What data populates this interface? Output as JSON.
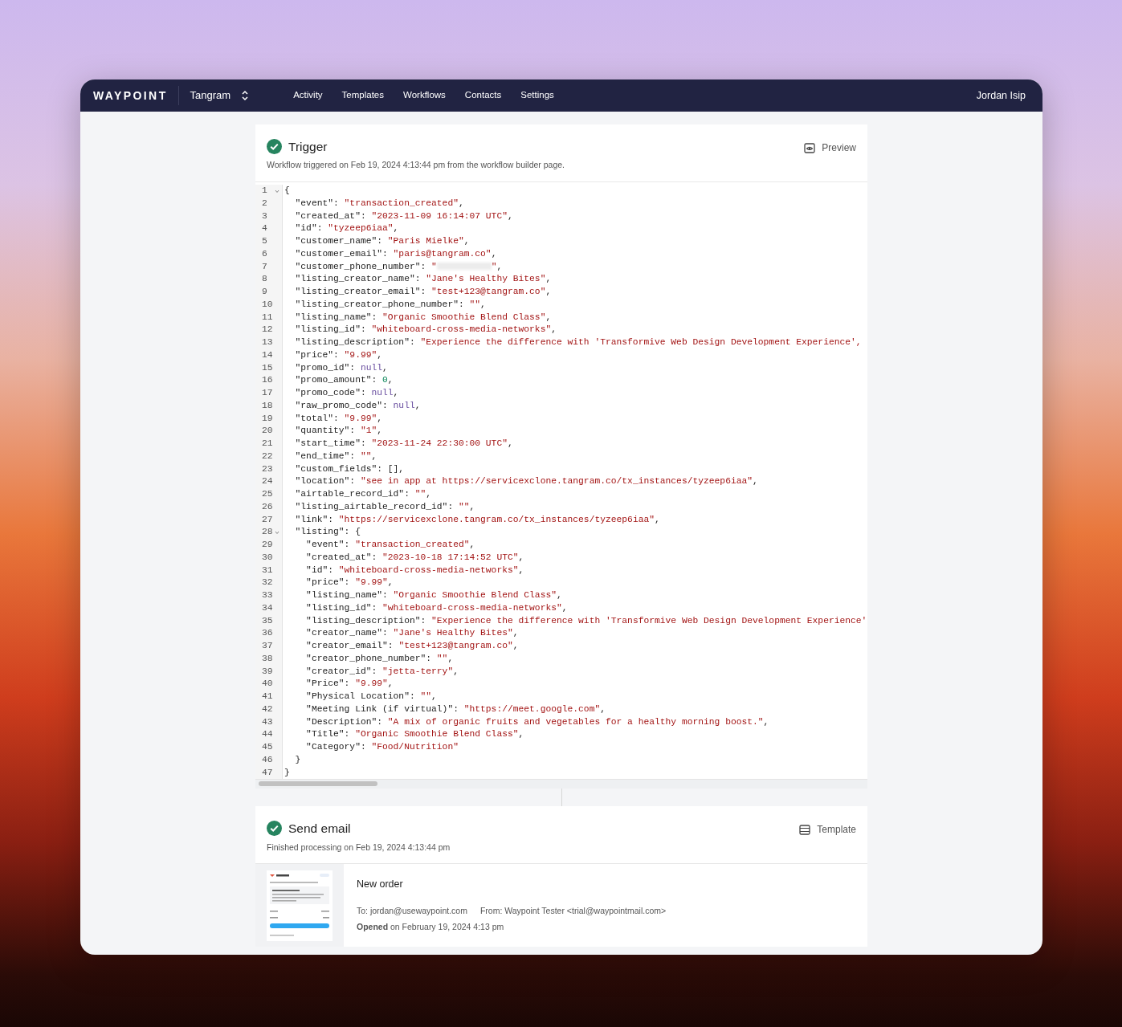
{
  "navbar": {
    "brand": "WAYPOINT",
    "workspace": "Tangram",
    "links": [
      {
        "label": "Activity",
        "selected": false
      },
      {
        "label": "Templates",
        "selected": false
      },
      {
        "label": "Workflows",
        "selected": false
      },
      {
        "label": "Contacts",
        "selected": false
      },
      {
        "label": "Settings",
        "selected": false
      }
    ],
    "user": "Jordan Isip"
  },
  "trigger": {
    "title": "Trigger",
    "done": true,
    "action": "Preview",
    "subtitle": "Workflow triggered on Feb 19, 2024 4:13:44 pm from the workflow builder page.",
    "code": [
      {
        "number": "1",
        "expanded": true,
        "tokens": [
          {
            "kind": "plain",
            "text": "{"
          }
        ]
      },
      {
        "number": "2",
        "tokens": [
          {
            "kind": "plain",
            "text": "  \"event\": "
          },
          {
            "kind": "string",
            "text": "\"transaction_created\""
          },
          {
            "kind": "plain",
            "text": ","
          }
        ]
      },
      {
        "number": "3",
        "tokens": [
          {
            "kind": "plain",
            "text": "  \"created_at\": "
          },
          {
            "kind": "string",
            "text": "\"2023-11-09 16:14:07 UTC\""
          },
          {
            "kind": "plain",
            "text": ","
          }
        ]
      },
      {
        "number": "4",
        "tokens": [
          {
            "kind": "plain",
            "text": "  \"id\": "
          },
          {
            "kind": "string",
            "text": "\"tyzeep6iaa\""
          },
          {
            "kind": "plain",
            "text": ","
          }
        ]
      },
      {
        "number": "5",
        "tokens": [
          {
            "kind": "plain",
            "text": "  \"customer_name\": "
          },
          {
            "kind": "string",
            "text": "\"Paris Mielke\""
          },
          {
            "kind": "plain",
            "text": ","
          }
        ]
      },
      {
        "number": "6",
        "tokens": [
          {
            "kind": "plain",
            "text": "  \"customer_email\": "
          },
          {
            "kind": "string",
            "text": "\"paris@tangram.co\""
          },
          {
            "kind": "plain",
            "text": ","
          }
        ]
      },
      {
        "number": "7",
        "tokens": [
          {
            "kind": "plain",
            "text": "  \"customer_phone_number\": "
          },
          {
            "kind": "string",
            "text": "\""
          },
          {
            "kind": "redacted"
          },
          {
            "kind": "string",
            "text": "\""
          },
          {
            "kind": "plain",
            "text": ","
          }
        ]
      },
      {
        "number": "8",
        "tokens": [
          {
            "kind": "plain",
            "text": "  \"listing_creator_name\": "
          },
          {
            "kind": "string",
            "text": "\"Jane's Healthy Bites\""
          },
          {
            "kind": "plain",
            "text": ","
          }
        ]
      },
      {
        "number": "9",
        "tokens": [
          {
            "kind": "plain",
            "text": "  \"listing_creator_email\": "
          },
          {
            "kind": "string",
            "text": "\"test+123@tangram.co\""
          },
          {
            "kind": "plain",
            "text": ","
          }
        ]
      },
      {
        "number": "10",
        "tokens": [
          {
            "kind": "plain",
            "text": "  \"listing_creator_phone_number\": "
          },
          {
            "kind": "string",
            "text": "\"\""
          },
          {
            "kind": "plain",
            "text": ","
          }
        ]
      },
      {
        "number": "11",
        "tokens": [
          {
            "kind": "plain",
            "text": "  \"listing_name\": "
          },
          {
            "kind": "string",
            "text": "\"Organic Smoothie Blend Class\""
          },
          {
            "kind": "plain",
            "text": ","
          }
        ]
      },
      {
        "number": "12",
        "tokens": [
          {
            "kind": "plain",
            "text": "  \"listing_id\": "
          },
          {
            "kind": "string",
            "text": "\"whiteboard-cross-media-networks\""
          },
          {
            "kind": "plain",
            "text": ","
          }
        ]
      },
      {
        "number": "13",
        "tokens": [
          {
            "kind": "plain",
            "text": "  \"listing_description\": "
          },
          {
            "kind": "string",
            "text": "\"Experience the difference with 'Transformive Web Design Development Experience',"
          }
        ]
      },
      {
        "number": "14",
        "tokens": [
          {
            "kind": "plain",
            "text": "  \"price\": "
          },
          {
            "kind": "string",
            "text": "\"9.99\""
          },
          {
            "kind": "plain",
            "text": ","
          }
        ]
      },
      {
        "number": "15",
        "tokens": [
          {
            "kind": "plain",
            "text": "  \"promo_id\": "
          },
          {
            "kind": "keyword",
            "text": "null"
          },
          {
            "kind": "plain",
            "text": ","
          }
        ]
      },
      {
        "number": "16",
        "tokens": [
          {
            "kind": "plain",
            "text": "  \"promo_amount\": "
          },
          {
            "kind": "number",
            "text": "0"
          },
          {
            "kind": "plain",
            "text": ","
          }
        ]
      },
      {
        "number": "17",
        "tokens": [
          {
            "kind": "plain",
            "text": "  \"promo_code\": "
          },
          {
            "kind": "keyword",
            "text": "null"
          },
          {
            "kind": "plain",
            "text": ","
          }
        ]
      },
      {
        "number": "18",
        "tokens": [
          {
            "kind": "plain",
            "text": "  \"raw_promo_code\": "
          },
          {
            "kind": "keyword",
            "text": "null"
          },
          {
            "kind": "plain",
            "text": ","
          }
        ]
      },
      {
        "number": "19",
        "tokens": [
          {
            "kind": "plain",
            "text": "  \"total\": "
          },
          {
            "kind": "string",
            "text": "\"9.99\""
          },
          {
            "kind": "plain",
            "text": ","
          }
        ]
      },
      {
        "number": "20",
        "tokens": [
          {
            "kind": "plain",
            "text": "  \"quantity\": "
          },
          {
            "kind": "string",
            "text": "\"1\""
          },
          {
            "kind": "plain",
            "text": ","
          }
        ]
      },
      {
        "number": "21",
        "tokens": [
          {
            "kind": "plain",
            "text": "  \"start_time\": "
          },
          {
            "kind": "string",
            "text": "\"2023-11-24 22:30:00 UTC\""
          },
          {
            "kind": "plain",
            "text": ","
          }
        ]
      },
      {
        "number": "22",
        "tokens": [
          {
            "kind": "plain",
            "text": "  \"end_time\": "
          },
          {
            "kind": "string",
            "text": "\"\""
          },
          {
            "kind": "plain",
            "text": ","
          }
        ]
      },
      {
        "number": "23",
        "tokens": [
          {
            "kind": "plain",
            "text": "  \"custom_fields\": [],"
          }
        ]
      },
      {
        "number": "24",
        "tokens": [
          {
            "kind": "plain",
            "text": "  \"location\": "
          },
          {
            "kind": "string",
            "text": "\"see in app at https://servicexclone.tangram.co/tx_instances/tyzeep6iaa\""
          },
          {
            "kind": "plain",
            "text": ","
          }
        ]
      },
      {
        "number": "25",
        "tokens": [
          {
            "kind": "plain",
            "text": "  \"airtable_record_id\": "
          },
          {
            "kind": "string",
            "text": "\"\""
          },
          {
            "kind": "plain",
            "text": ","
          }
        ]
      },
      {
        "number": "26",
        "tokens": [
          {
            "kind": "plain",
            "text": "  \"listing_airtable_record_id\": "
          },
          {
            "kind": "string",
            "text": "\"\""
          },
          {
            "kind": "plain",
            "text": ","
          }
        ]
      },
      {
        "number": "27",
        "tokens": [
          {
            "kind": "plain",
            "text": "  \"link\": "
          },
          {
            "kind": "string",
            "text": "\"https://servicexclone.tangram.co/tx_instances/tyzeep6iaa\""
          },
          {
            "kind": "plain",
            "text": ","
          }
        ]
      },
      {
        "number": "28",
        "expanded": true,
        "tokens": [
          {
            "kind": "plain",
            "text": "  \"listing\": {"
          }
        ]
      },
      {
        "number": "29",
        "tokens": [
          {
            "kind": "plain",
            "text": "    \"event\": "
          },
          {
            "kind": "string",
            "text": "\"transaction_created\""
          },
          {
            "kind": "plain",
            "text": ","
          }
        ]
      },
      {
        "number": "30",
        "tokens": [
          {
            "kind": "plain",
            "text": "    \"created_at\": "
          },
          {
            "kind": "string",
            "text": "\"2023-10-18 17:14:52 UTC\""
          },
          {
            "kind": "plain",
            "text": ","
          }
        ]
      },
      {
        "number": "31",
        "tokens": [
          {
            "kind": "plain",
            "text": "    \"id\": "
          },
          {
            "kind": "string",
            "text": "\"whiteboard-cross-media-networks\""
          },
          {
            "kind": "plain",
            "text": ","
          }
        ]
      },
      {
        "number": "32",
        "tokens": [
          {
            "kind": "plain",
            "text": "    \"price\": "
          },
          {
            "kind": "string",
            "text": "\"9.99\""
          },
          {
            "kind": "plain",
            "text": ","
          }
        ]
      },
      {
        "number": "33",
        "tokens": [
          {
            "kind": "plain",
            "text": "    \"listing_name\": "
          },
          {
            "kind": "string",
            "text": "\"Organic Smoothie Blend Class\""
          },
          {
            "kind": "plain",
            "text": ","
          }
        ]
      },
      {
        "number": "34",
        "tokens": [
          {
            "kind": "plain",
            "text": "    \"listing_id\": "
          },
          {
            "kind": "string",
            "text": "\"whiteboard-cross-media-networks\""
          },
          {
            "kind": "plain",
            "text": ","
          }
        ]
      },
      {
        "number": "35",
        "tokens": [
          {
            "kind": "plain",
            "text": "    \"listing_description\": "
          },
          {
            "kind": "string",
            "text": "\"Experience the difference with 'Transformive Web Design Development Experience'"
          }
        ]
      },
      {
        "number": "36",
        "tokens": [
          {
            "kind": "plain",
            "text": "    \"creator_name\": "
          },
          {
            "kind": "string",
            "text": "\"Jane's Healthy Bites\""
          },
          {
            "kind": "plain",
            "text": ","
          }
        ]
      },
      {
        "number": "37",
        "tokens": [
          {
            "kind": "plain",
            "text": "    \"creator_email\": "
          },
          {
            "kind": "string",
            "text": "\"test+123@tangram.co\""
          },
          {
            "kind": "plain",
            "text": ","
          }
        ]
      },
      {
        "number": "38",
        "tokens": [
          {
            "kind": "plain",
            "text": "    \"creator_phone_number\": "
          },
          {
            "kind": "string",
            "text": "\"\""
          },
          {
            "kind": "plain",
            "text": ","
          }
        ]
      },
      {
        "number": "39",
        "tokens": [
          {
            "kind": "plain",
            "text": "    \"creator_id\": "
          },
          {
            "kind": "string",
            "text": "\"jetta-terry\""
          },
          {
            "kind": "plain",
            "text": ","
          }
        ]
      },
      {
        "number": "40",
        "tokens": [
          {
            "kind": "plain",
            "text": "    \"Price\": "
          },
          {
            "kind": "string",
            "text": "\"9.99\""
          },
          {
            "kind": "plain",
            "text": ","
          }
        ]
      },
      {
        "number": "41",
        "tokens": [
          {
            "kind": "plain",
            "text": "    \"Physical Location\": "
          },
          {
            "kind": "string",
            "text": "\"\""
          },
          {
            "kind": "plain",
            "text": ","
          }
        ]
      },
      {
        "number": "42",
        "tokens": [
          {
            "kind": "plain",
            "text": "    \"Meeting Link (if virtual)\": "
          },
          {
            "kind": "string",
            "text": "\"https://meet.google.com\""
          },
          {
            "kind": "plain",
            "text": ","
          }
        ]
      },
      {
        "number": "43",
        "tokens": [
          {
            "kind": "plain",
            "text": "    \"Description\": "
          },
          {
            "kind": "string",
            "text": "\"A mix of organic fruits and vegetables for a healthy morning boost.\""
          },
          {
            "kind": "plain",
            "text": ","
          }
        ]
      },
      {
        "number": "44",
        "tokens": [
          {
            "kind": "plain",
            "text": "    \"Title\": "
          },
          {
            "kind": "string",
            "text": "\"Organic Smoothie Blend Class\""
          },
          {
            "kind": "plain",
            "text": ","
          }
        ]
      },
      {
        "number": "45",
        "tokens": [
          {
            "kind": "plain",
            "text": "    \"Category\": "
          },
          {
            "kind": "string",
            "text": "\"Food/Nutrition\""
          }
        ]
      },
      {
        "number": "46",
        "tokens": [
          {
            "kind": "plain",
            "text": "  }"
          }
        ]
      },
      {
        "number": "47",
        "tokens": [
          {
            "kind": "plain",
            "text": "}"
          }
        ]
      }
    ]
  },
  "send_email": {
    "title": "Send email",
    "done": true,
    "action": "Template",
    "subtitle": "Finished processing on Feb 19, 2024 4:13:44 pm",
    "email": {
      "subject": "New order",
      "to": "To: jordan@usewaypoint.com",
      "from": "From: Waypoint Tester <trial@waypointmail.com>",
      "status": "**Opened** on February 19, 2024 4:13 pm"
    }
  }
}
